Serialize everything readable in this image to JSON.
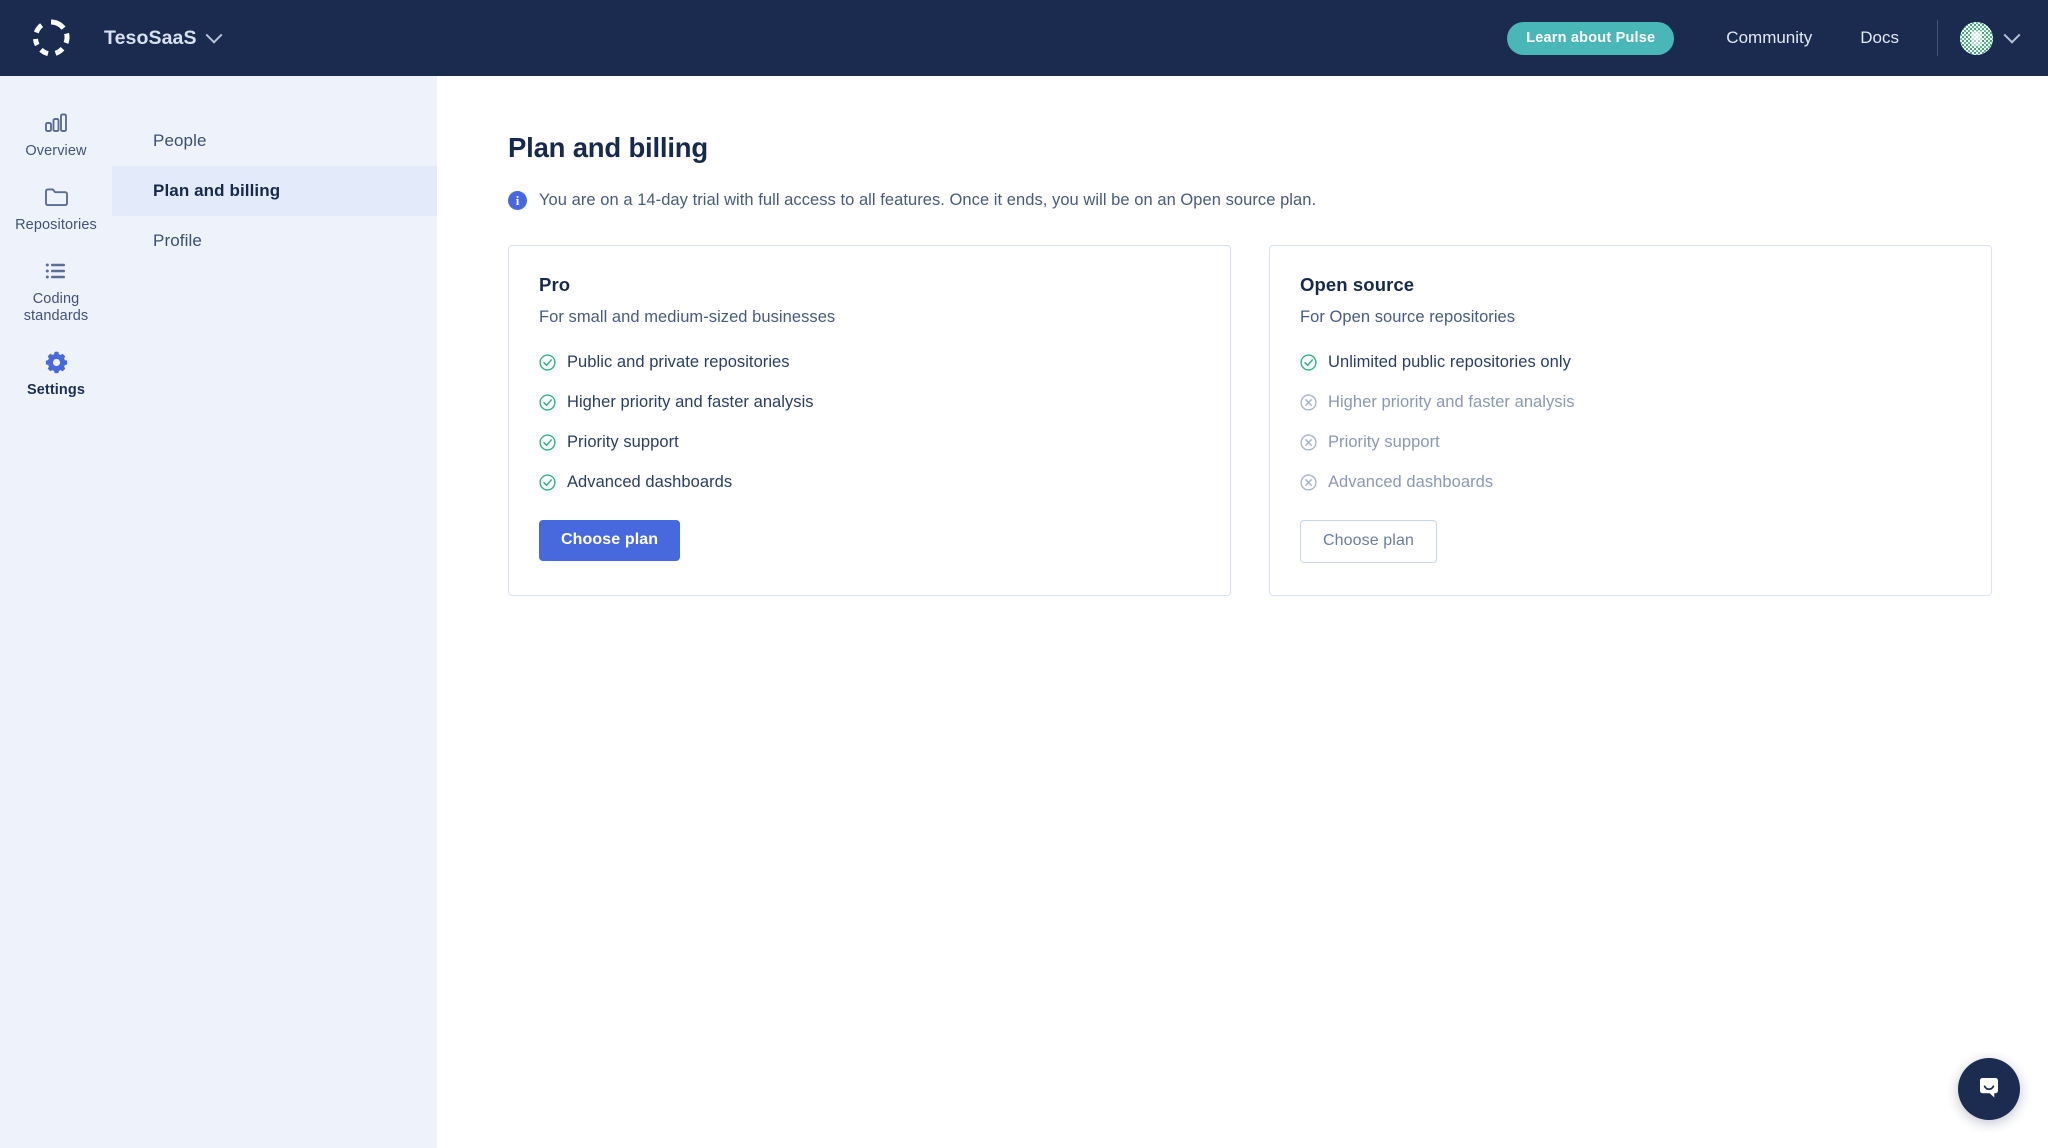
{
  "topbar": {
    "logo_icon": "dashed-circle-logo-icon",
    "org_name": "TesoSaaS",
    "org_chevron_icon": "chevron-down-icon",
    "pulse_button": "Learn about Pulse",
    "links": [
      {
        "label": "Community"
      },
      {
        "label": "Docs"
      }
    ],
    "avatar_icon": "user-avatar",
    "avatar_chevron_icon": "chevron-down-icon",
    "accent_teal": "#49b7b7",
    "background": "#1a2b4f"
  },
  "rail": {
    "items": [
      {
        "label": "Overview",
        "icon": "bar-chart-icon",
        "active": false
      },
      {
        "label": "Repositories",
        "icon": "folder-icon",
        "active": false
      },
      {
        "label": "Coding standards",
        "icon": "list-icon",
        "active": false
      },
      {
        "label": "Settings",
        "icon": "gear-icon",
        "active": true
      }
    ],
    "active_color": "#4869dd",
    "inactive_color": "#5c6d94",
    "background": "#edf2fb"
  },
  "subnav": {
    "items": [
      {
        "label": "People",
        "active": false
      },
      {
        "label": "Plan and billing",
        "active": true
      },
      {
        "label": "Profile",
        "active": false
      }
    ]
  },
  "main": {
    "title": "Plan and billing",
    "banner": {
      "icon": "info-icon",
      "text": "You are on a 14-day trial with full access to all features. Once it ends, you will be on an Open source plan."
    },
    "plans": [
      {
        "name": "Pro",
        "description": "For small and medium-sized businesses",
        "features": [
          {
            "label": "Public and private repositories",
            "included": true
          },
          {
            "label": "Higher priority and faster analysis",
            "included": true
          },
          {
            "label": "Priority support",
            "included": true
          },
          {
            "label": "Advanced dashboards",
            "included": true
          }
        ],
        "button": {
          "label": "Choose plan",
          "style": "primary"
        }
      },
      {
        "name": "Open source",
        "description": "For Open source repositories",
        "features": [
          {
            "label": "Unlimited public repositories only",
            "included": true
          },
          {
            "label": "Higher priority and faster analysis",
            "included": false
          },
          {
            "label": "Priority support",
            "included": false
          },
          {
            "label": "Advanced dashboards",
            "included": false
          }
        ],
        "button": {
          "label": "Choose plan",
          "style": "secondary"
        }
      }
    ],
    "colors": {
      "primary_blue": "#4869dd",
      "check_green": "#35b37e",
      "disabled_gray": "#a9b5cc",
      "card_border": "#d7e1f2"
    }
  },
  "chat": {
    "icon": "chat-bubble-smile-icon",
    "background": "#1b2c50"
  }
}
